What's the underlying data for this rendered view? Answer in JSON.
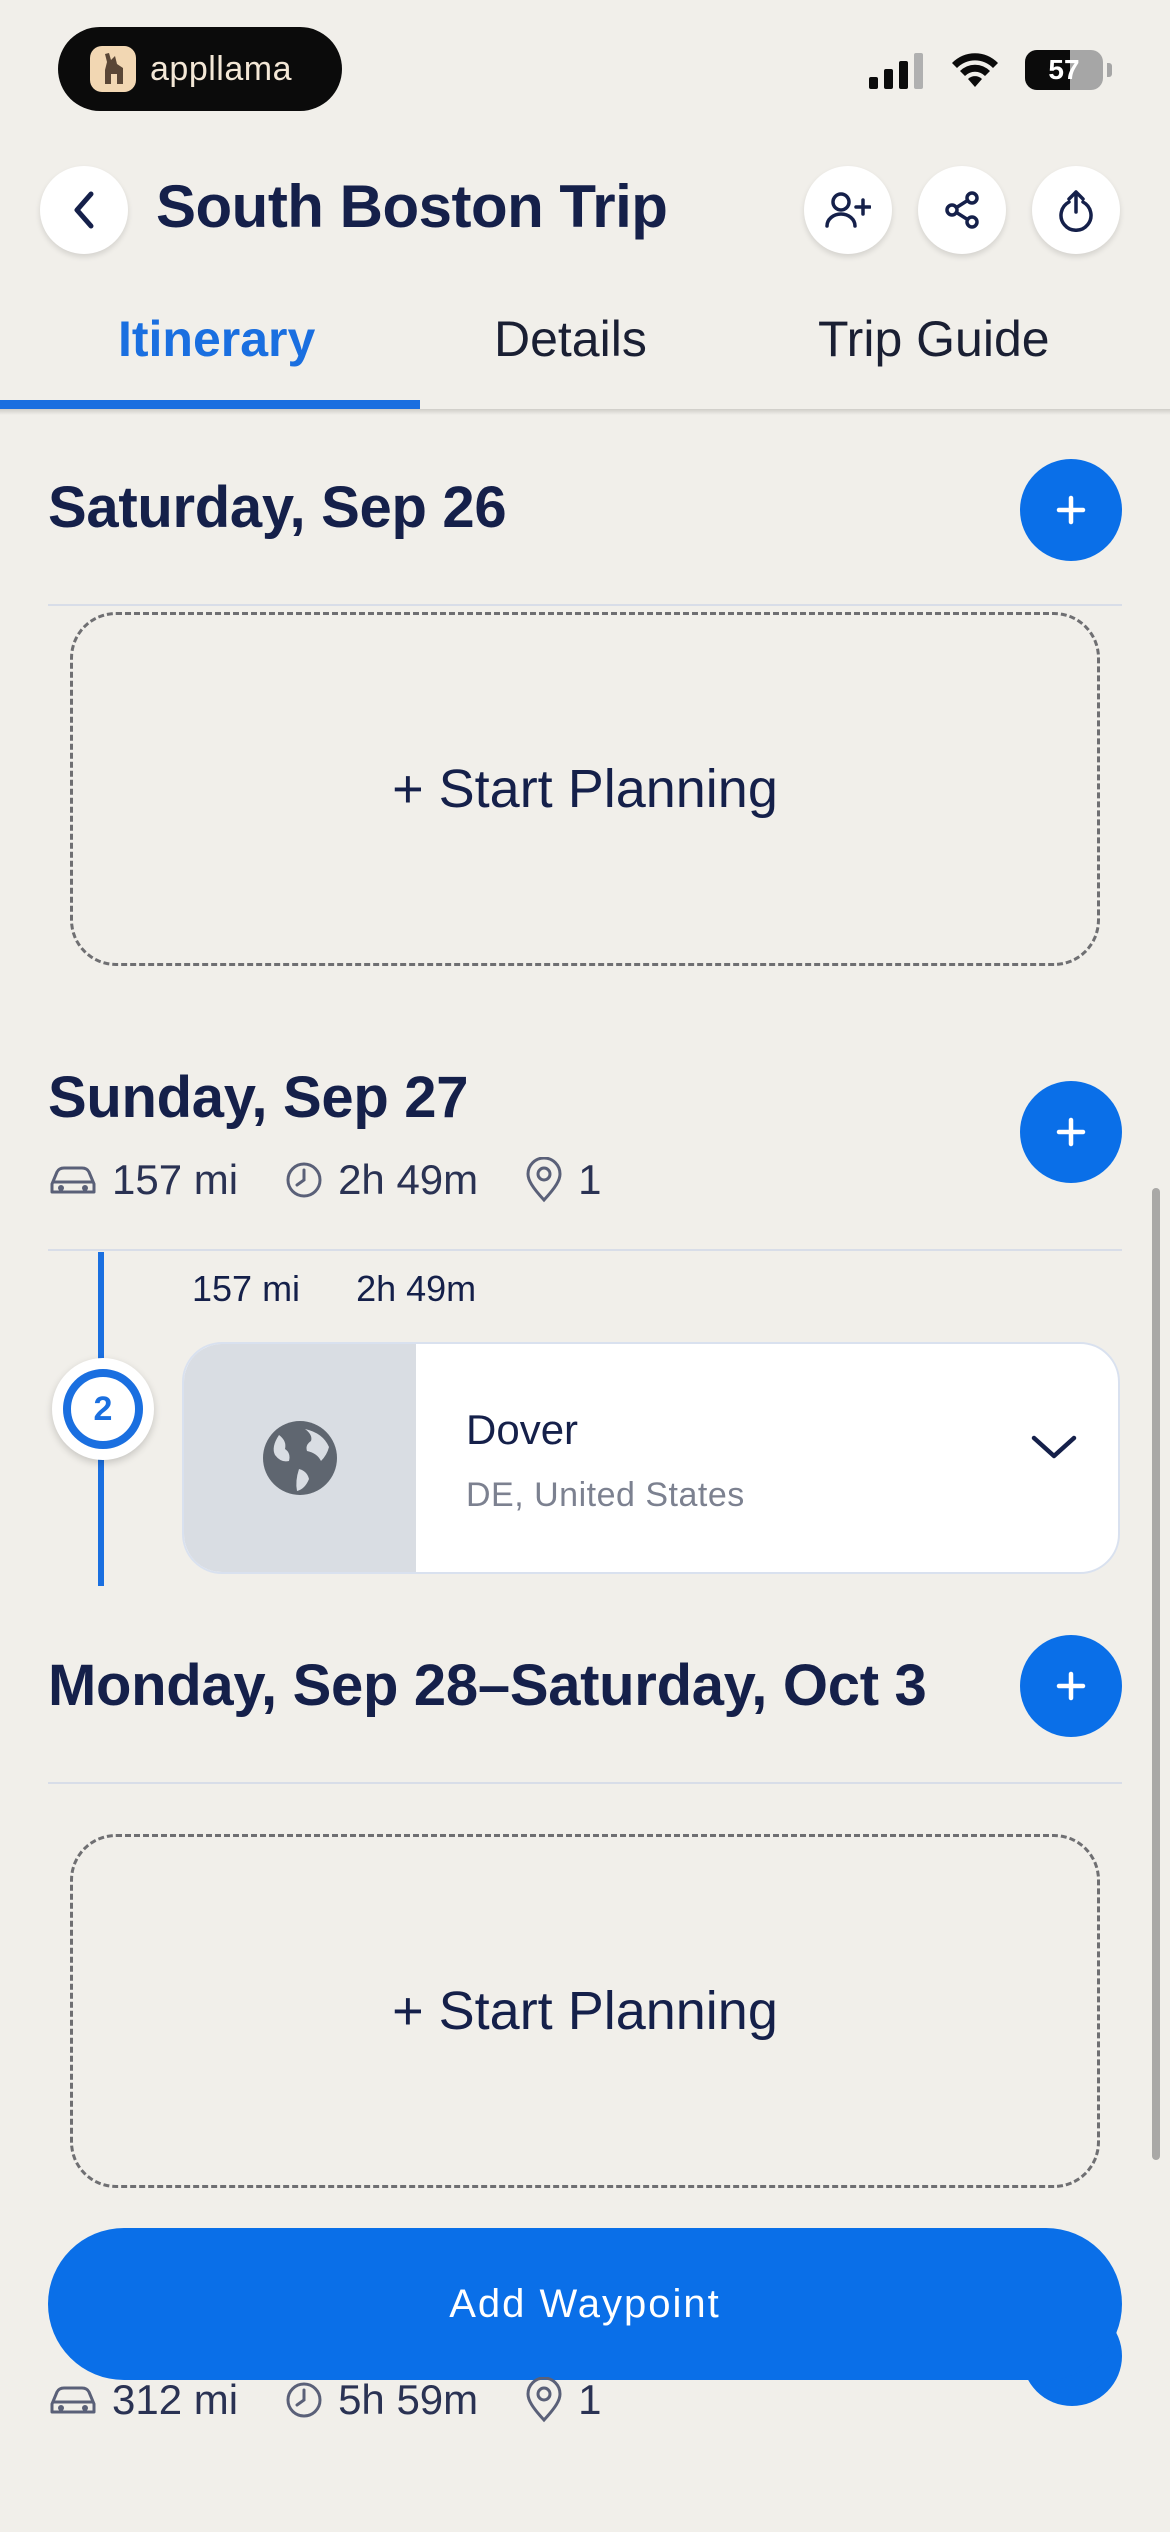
{
  "status_bar": {
    "app_name": "appllama",
    "battery": "57",
    "battery_level": 0.57
  },
  "header": {
    "title": "South Boston Trip",
    "icons": [
      "back-icon",
      "add-person-icon",
      "share-icon",
      "export-icon"
    ]
  },
  "tabs": [
    {
      "label": "Itinerary",
      "active": true
    },
    {
      "label": "Details",
      "active": false
    },
    {
      "label": "Trip Guide",
      "active": false
    }
  ],
  "days": [
    {
      "title": "Saturday, Sep 26",
      "start_planning": "+ Start Planning"
    },
    {
      "title": "Sunday, Sep 27",
      "distance": "157 mi",
      "duration": "2h 49m",
      "stops": "1",
      "waypoint": {
        "number": "2",
        "segment_distance": "157 mi",
        "segment_duration": "2h 49m",
        "name": "Dover",
        "location": "DE, United States"
      }
    },
    {
      "title": "Monday, Sep 28 – Saturday, Oct 3",
      "title_start": "Monday, Sep 28",
      "title_end": "Saturday, Oct 3",
      "start_planning": "+ Start Planning"
    }
  ],
  "footer": {
    "add_waypoint_label": "Add Waypoint",
    "distance": "312 mi",
    "duration": "5h 59m",
    "stops": "1"
  },
  "colors": {
    "background": "#f1efea",
    "accent": "#0a6fe8",
    "text": "#15204a"
  }
}
